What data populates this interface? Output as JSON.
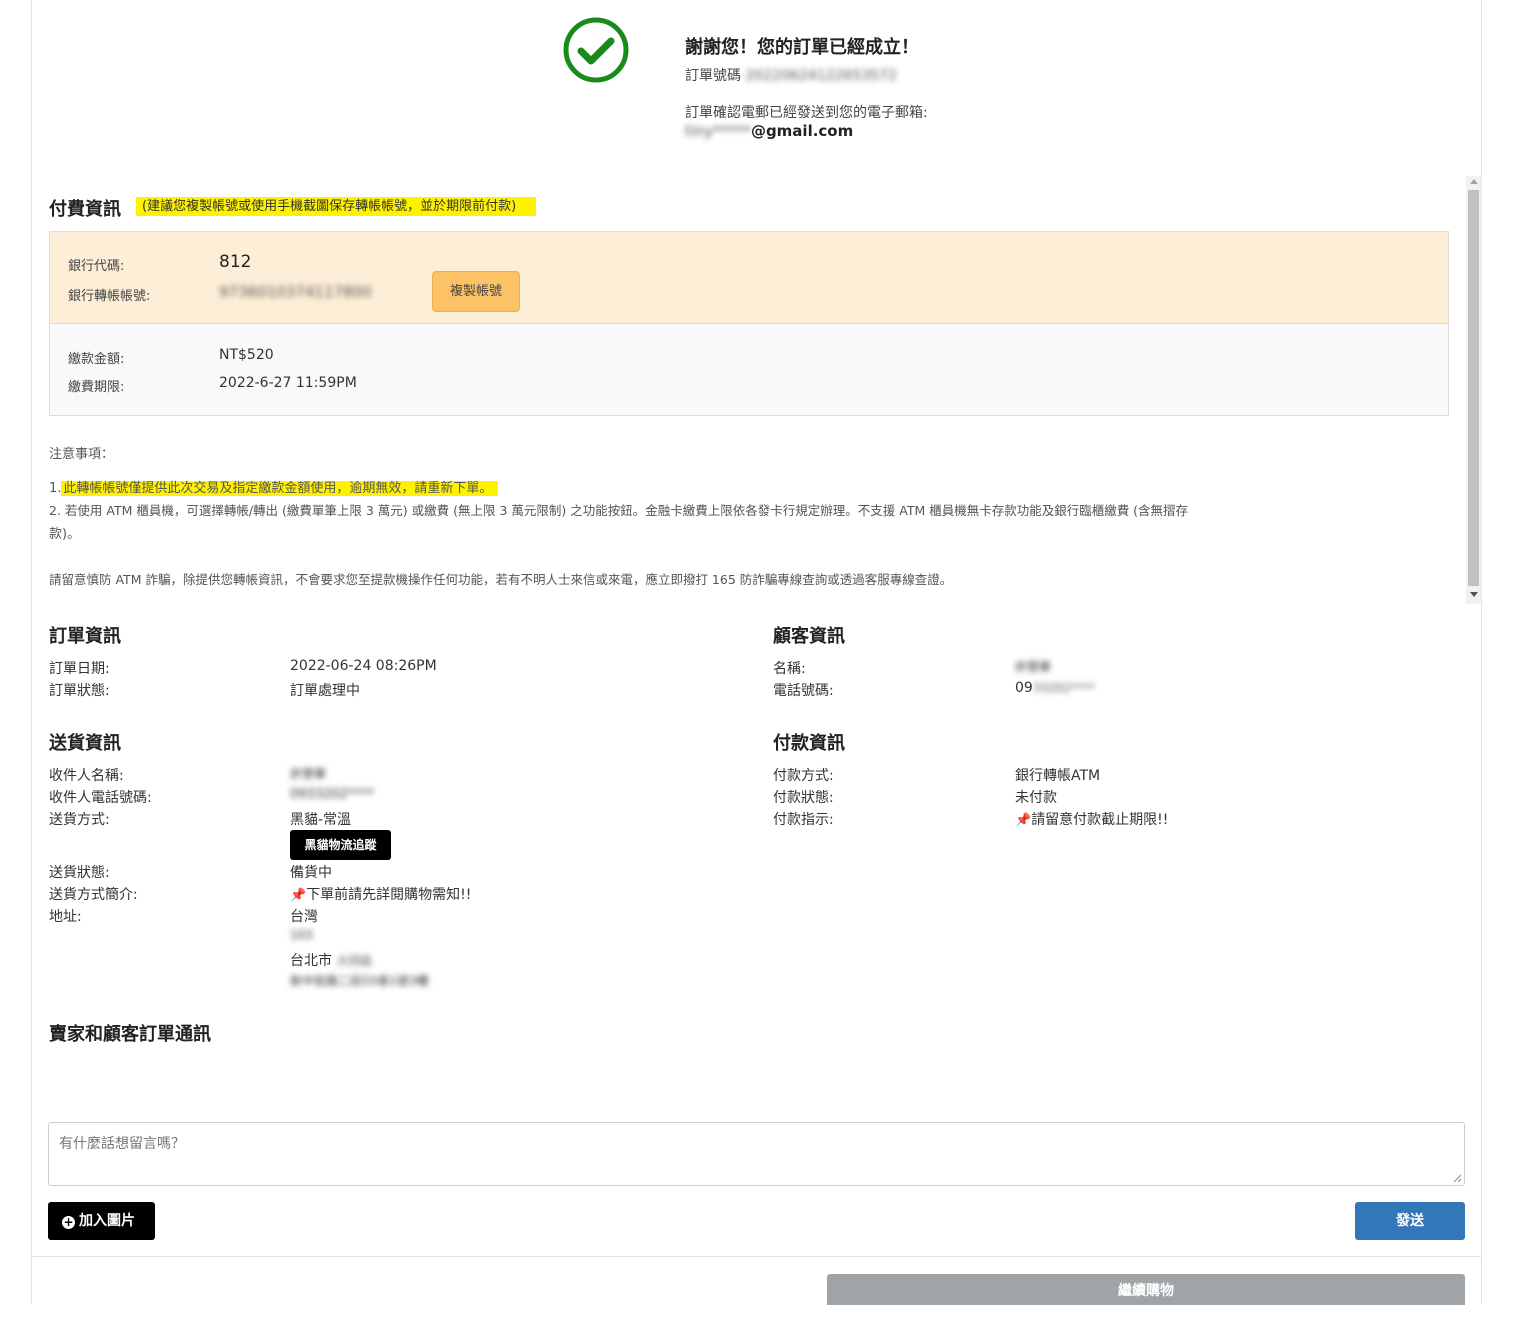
{
  "header": {
    "thanks": "謝謝您！您的訂單已經成立！",
    "order_no_label": "訂單號碼",
    "order_no_value": "20220624122653572",
    "email_msg": "訂單確認電郵已經發送到您的電子郵箱:",
    "email_masked_prefix": "tiny*****",
    "email_domain": "@gmail.com"
  },
  "payment": {
    "title": "付費資訊",
    "hint": "(建議您複製帳號或使用手機截圖保存轉帳帳號，並於期限前付款)",
    "bank_code_label": "銀行代碼:",
    "bank_code": "812",
    "account_label": "銀行轉帳帳號:",
    "account_value": "9736010374117800",
    "copy_button": "複製帳號",
    "amount_label": "繳款金額:",
    "amount": "NT$520",
    "deadline_label": "繳費期限:",
    "deadline": "2022-6-27 11:59PM"
  },
  "notes": {
    "heading": "注意事項：",
    "item1_prefix": "1.",
    "item1": "此轉帳帳號僅提供此次交易及指定繳款金額使用，逾期無效，請重新下單。",
    "item2_line1": "2. 若使用 ATM 櫃員機，可選擇轉帳/轉出 (繳費單筆上限 3 萬元) 或繳費 (無上限 3 萬元限制) 之功能按鈕。金融卡繳費上限依各發卡行規定辦理。不支援 ATM 櫃員機無卡存款功能及銀行臨櫃繳費 (含無摺存",
    "item2_line2": "款)。",
    "warning": "請留意慎防 ATM 詐騙，除提供您轉帳資訊，不會要求您至提款機操作任何功能，若有不明人士來信或來電，應立即撥打 165 防詐騙專線查詢或透過客服專線查證。"
  },
  "order_info": {
    "title": "訂單資訊",
    "date_label": "訂單日期:",
    "date": "2022-06-24 08:26PM",
    "status_label": "訂單狀態:",
    "status": "訂單處理中"
  },
  "customer_info": {
    "title": "顧客資訊",
    "name_label": "名稱:",
    "name": "許慧華",
    "phone_label": "電話號碼:",
    "phone_prefix": "09",
    "phone_rest": "33202****"
  },
  "shipping_info": {
    "title": "送貨資訊",
    "recipient_label": "收件人名稱:",
    "recipient": "許慧華",
    "recipient_phone_label": "收件人電話號碼:",
    "recipient_phone": "0933202****",
    "method_label": "送貨方式:",
    "method": "黑貓-常溫",
    "track_button": "黑貓物流追蹤",
    "status_label": "送貨狀態:",
    "status": "備貨中",
    "method_desc_label": "送貨方式簡介:",
    "method_desc": "下單前請先詳閱購物需知!!",
    "address_label": "地址:",
    "address_country": "台灣",
    "address_zip": "103",
    "address_city": "台北市",
    "address_district": "大同區",
    "address_street": "新中街路二段55巷1號3樓"
  },
  "payment_info": {
    "title": "付款資訊",
    "method_label": "付款方式:",
    "method": "銀行轉帳ATM",
    "status_label": "付款狀態:",
    "status": "未付款",
    "instruction_label": "付款指示:",
    "instruction": "請留意付款截止期限!!"
  },
  "messages": {
    "title": "賣家和顧客訂單通訊",
    "placeholder": "有什麼話想留言嗎？",
    "add_image_button": "加入圖片",
    "send_button": "發送"
  },
  "footer": {
    "continue_button": "繼續購物"
  },
  "colors": {
    "check_green": "#1a8a1a",
    "highlight": "#fff200",
    "bank_box_bg": "#fdefd7",
    "copy_button_bg": "#fcc266",
    "send_button_bg": "#3477b8",
    "continue_button_bg": "#9ea4a8"
  }
}
